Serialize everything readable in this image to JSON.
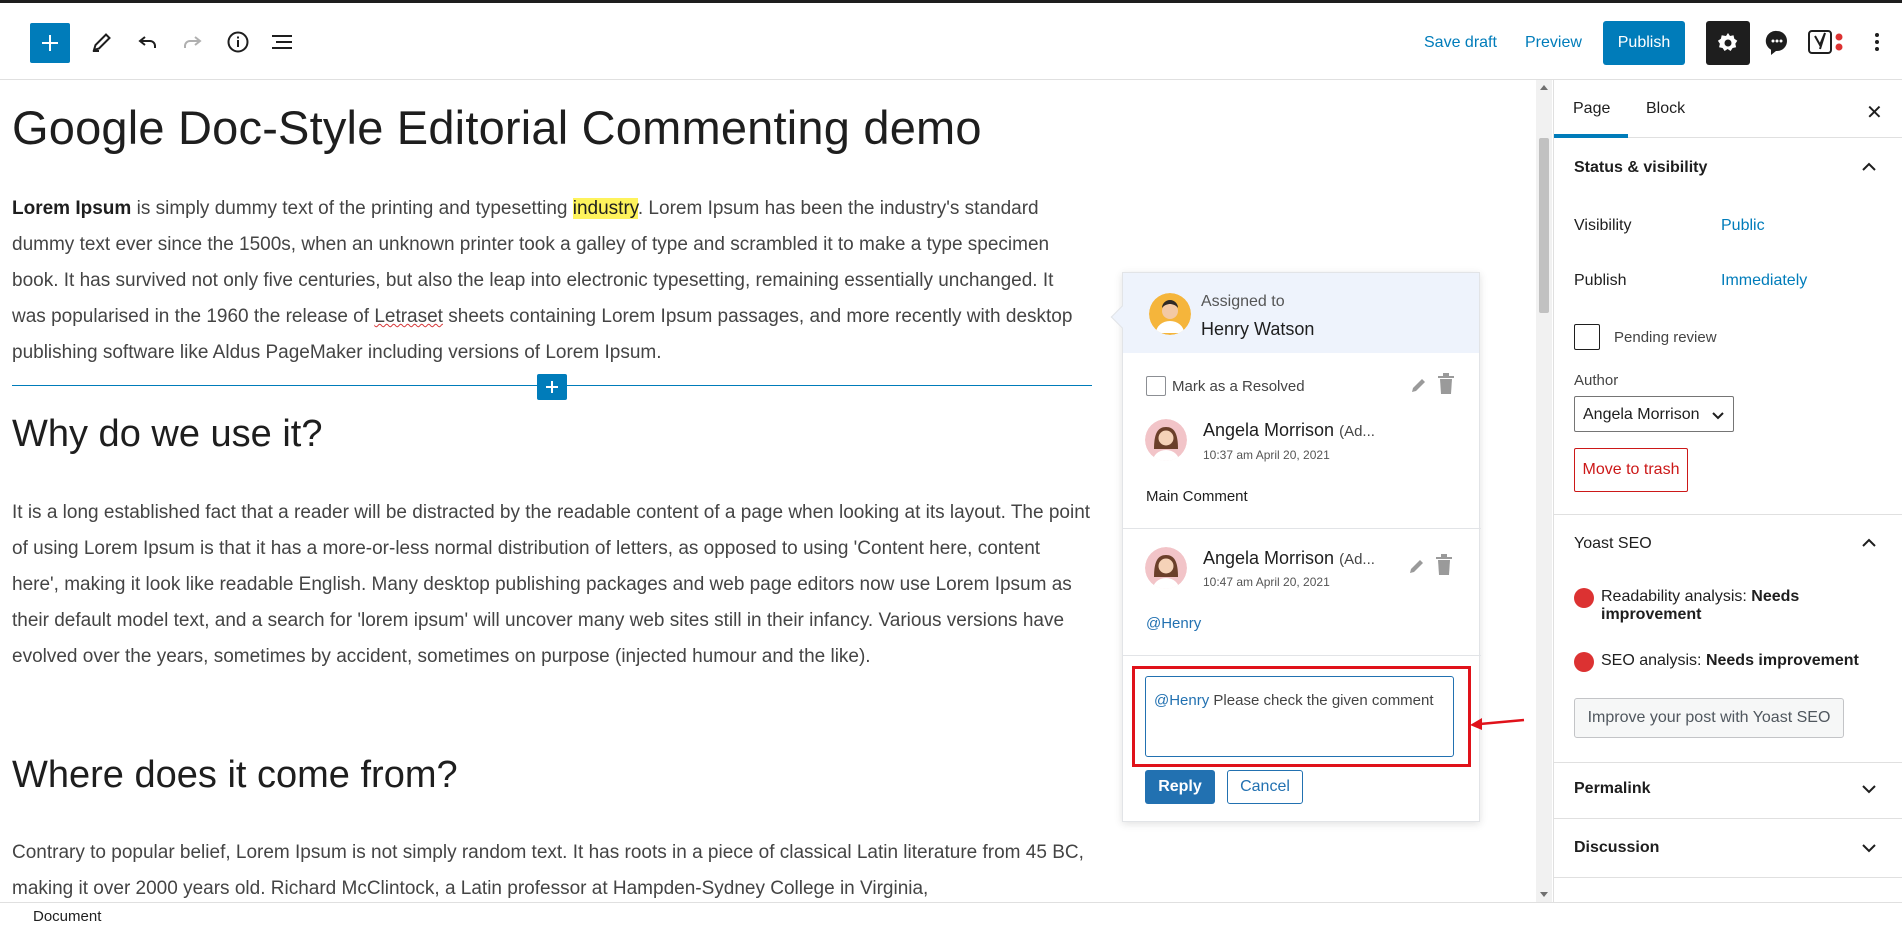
{
  "toolbar": {
    "save_draft": "Save draft",
    "preview": "Preview",
    "publish": "Publish"
  },
  "editor": {
    "title": "Google Doc-Style Editorial Commenting demo",
    "p1": {
      "bold": "Lorem Ipsum",
      "a": " is simply dummy text of the printing and typesetting ",
      "highlight": "industry",
      "b": ". Lorem Ipsum has been the industry's standard dummy text ever since the 1500s, when an unknown printer took a galley of type and scrambled it to make a type specimen book. It has survived not only five centuries, but also the leap into electronic typesetting, remaining essentially unchanged. It was popularised in the 1960 the release of ",
      "misspelled": "Letraset",
      "c": " sheets containing Lorem Ipsum passages, and more recently with desktop publishing software like Aldus PageMaker including versions of Lorem Ipsum."
    },
    "h2_why": "Why do we use it?",
    "p2": "It is a long established fact that a reader will be distracted by the readable content of a page when looking at its layout. The point of using Lorem Ipsum is that it has a more-or-less normal distribution of letters, as opposed to using 'Content here, content here', making it look like readable English. Many desktop publishing packages and web page editors now use Lorem Ipsum as their default model text, and a search for 'lorem ipsum' will uncover many web sites still in their infancy. Various versions have evolved over the years, sometimes by accident, sometimes on purpose (injected humour and the like).",
    "h2_where": "Where does it come from?",
    "p3": "Contrary to popular belief, Lorem Ipsum is not simply random text. It has roots in a piece of classical Latin literature from 45 BC, making it over 2000 years old. Richard McClintock, a Latin professor at Hampden-Sydney College in Virginia,"
  },
  "comments": {
    "assigned_label": "Assigned to",
    "assigned_name": "Henry Watson",
    "mark_resolved": "Mark as a Resolved",
    "thread": [
      {
        "author": "Angela Morrison",
        "role": "(Ad...",
        "time": "10:37 am April 20, 2021",
        "text": "Main Comment"
      },
      {
        "author": "Angela Morrison",
        "role": "(Ad...",
        "time": "10:47 am April 20, 2021",
        "mention": "@Henry"
      }
    ],
    "reply_mention": "@Henry",
    "reply_text": " Please check the given comment",
    "reply_label": "Reply",
    "cancel_label": "Cancel"
  },
  "sidebar": {
    "tab_page": "Page",
    "tab_block": "Block",
    "close": "✕",
    "status_title": "Status & visibility",
    "visibility_label": "Visibility",
    "visibility_value": "Public",
    "publish_label": "Publish",
    "publish_value": "Immediately",
    "pending_review": "Pending review",
    "author_label": "Author",
    "author_value": "Angela Morrison",
    "move_trash": "Move to trash",
    "yoast_title": "Yoast SEO",
    "readability_label": "Readability analysis: ",
    "readability_value": "Needs improvement",
    "seo_label": "SEO analysis: ",
    "seo_value": "Needs improvement",
    "yoast_button": "Improve your post with Yoast SEO",
    "permalink": "Permalink",
    "discussion": "Discussion"
  },
  "footer": {
    "breadcrumb": "Document"
  },
  "colors": {
    "accent": "#007cba",
    "highlight": "#fef35c",
    "alert": "#e0121a"
  }
}
